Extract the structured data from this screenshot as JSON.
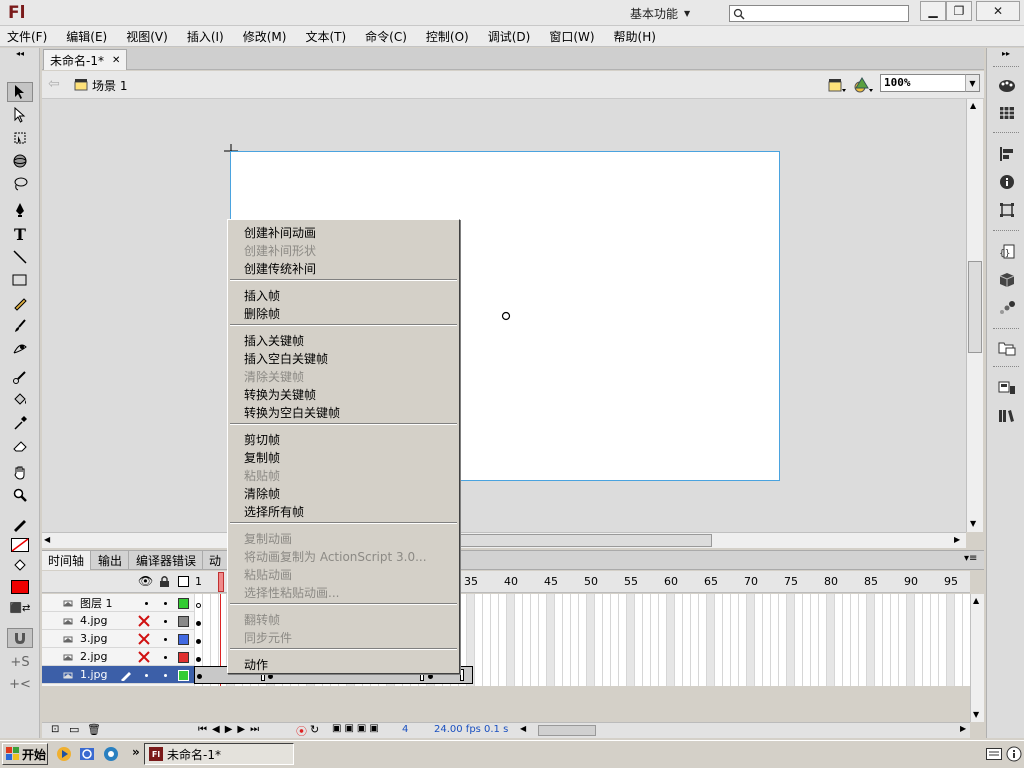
{
  "app": {
    "logo": "Fl",
    "workspace": "基本功能",
    "search_placeholder": ""
  },
  "menubar": [
    "文件(F)",
    "编辑(E)",
    "视图(V)",
    "插入(I)",
    "修改(M)",
    "文本(T)",
    "命令(C)",
    "控制(O)",
    "调试(D)",
    "窗口(W)",
    "帮助(H)"
  ],
  "document": {
    "tab_title": "未命名-1*",
    "scene": "场景 1",
    "zoom": "100%"
  },
  "timeline": {
    "tabs": [
      "时间轴",
      "输出",
      "编译器错误",
      "动"
    ],
    "frame_numbers": [
      "1",
      "35",
      "40",
      "45",
      "50",
      "55",
      "60",
      "65",
      "70",
      "75",
      "80",
      "85",
      "90",
      "95"
    ],
    "layers": [
      {
        "name": "图层 1",
        "color": "#33cc33",
        "hidden": false,
        "selected": false
      },
      {
        "name": "4.jpg",
        "color": "#888888",
        "hidden": true,
        "selected": false
      },
      {
        "name": "3.jpg",
        "color": "#4169e1",
        "hidden": true,
        "selected": false
      },
      {
        "name": "2.jpg",
        "color": "#e03030",
        "hidden": true,
        "selected": false
      },
      {
        "name": "1.jpg",
        "color": "#33cc33",
        "hidden": false,
        "selected": true
      }
    ],
    "status": {
      "frame": "4",
      "fps": "24.00 fps",
      "time": "0.1 s"
    }
  },
  "context_menu": [
    {
      "label": "创建补间动画",
      "enabled": true
    },
    {
      "label": "创建补间形状",
      "enabled": false
    },
    {
      "label": "创建传统补间",
      "enabled": true
    },
    {
      "label": "插入帧",
      "enabled": true
    },
    {
      "label": "删除帧",
      "enabled": true
    },
    {
      "label": "插入关键帧",
      "enabled": true
    },
    {
      "label": "插入空白关键帧",
      "enabled": true
    },
    {
      "label": "清除关键帧",
      "enabled": false
    },
    {
      "label": "转换为关键帧",
      "enabled": true
    },
    {
      "label": "转换为空白关键帧",
      "enabled": true
    },
    {
      "label": "剪切帧",
      "enabled": true
    },
    {
      "label": "复制帧",
      "enabled": true
    },
    {
      "label": "粘贴帧",
      "enabled": false
    },
    {
      "label": "清除帧",
      "enabled": true
    },
    {
      "label": "选择所有帧",
      "enabled": true
    },
    {
      "label": "复制动画",
      "enabled": false
    },
    {
      "label": "将动画复制为 ActionScript 3.0...",
      "enabled": false
    },
    {
      "label": "粘贴动画",
      "enabled": false
    },
    {
      "label": "选择性粘贴动画...",
      "enabled": false
    },
    {
      "label": "翻转帧",
      "enabled": false
    },
    {
      "label": "同步元件",
      "enabled": false
    },
    {
      "label": "动作",
      "enabled": true
    }
  ],
  "taskbar": {
    "start": "开始",
    "item": "未命名-1*",
    "overflow": "»"
  }
}
